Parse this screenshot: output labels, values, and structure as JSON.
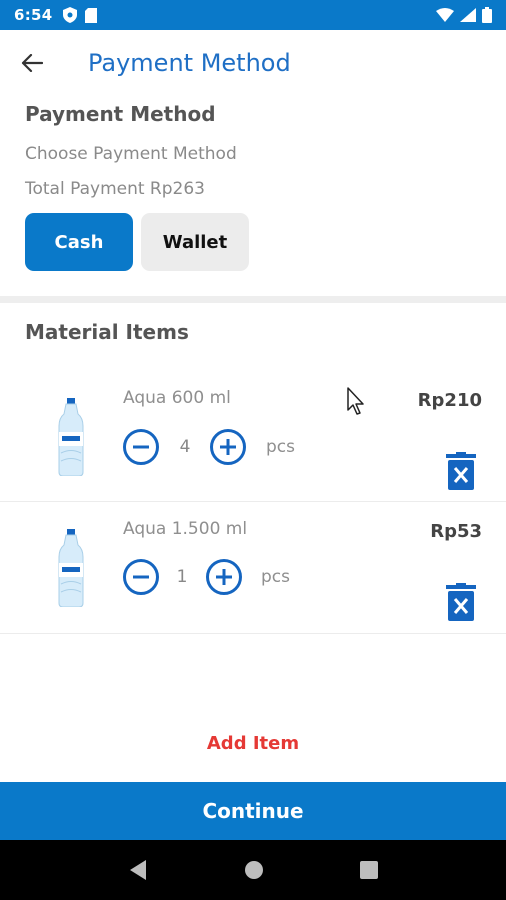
{
  "status_bar": {
    "time": "6:54"
  },
  "appbar": {
    "title": "Payment Method"
  },
  "payment": {
    "section_title": "Payment Method",
    "subtitle": "Choose Payment Method",
    "total": "Total Payment Rp263",
    "options": [
      "Cash",
      "Wallet"
    ],
    "selected": "Cash"
  },
  "materials": {
    "section_title": "Material Items",
    "items": [
      {
        "name": "Aqua 600 ml",
        "qty": "4",
        "unit": "pcs",
        "price": "Rp210"
      },
      {
        "name": "Aqua 1.500 ml",
        "qty": "1",
        "unit": "pcs",
        "price": "Rp53"
      }
    ]
  },
  "add_item_label": "Add Item",
  "continue_label": "Continue",
  "colors": {
    "primary": "#0a79c9",
    "title_blue": "#1f6fc5",
    "danger": "#e53935"
  }
}
